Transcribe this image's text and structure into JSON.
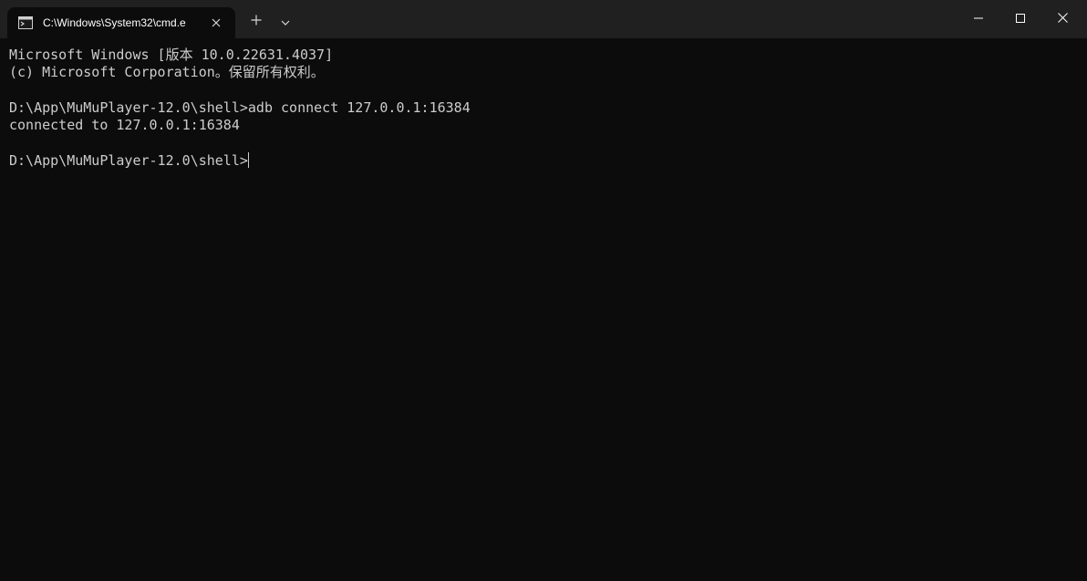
{
  "tab": {
    "title": "C:\\Windows\\System32\\cmd.e",
    "icon": "terminal-icon"
  },
  "titlebar": {
    "new_tab_icon": "plus-icon",
    "dropdown_icon": "chevron-down-icon",
    "minimize_icon": "minimize-icon",
    "maximize_icon": "maximize-icon",
    "close_icon": "close-icon"
  },
  "terminal": {
    "lines": [
      "Microsoft Windows [版本 10.0.22631.4037]",
      "(c) Microsoft Corporation。保留所有权利。",
      "",
      "D:\\App\\MuMuPlayer-12.0\\shell>adb connect 127.0.0.1:16384",
      "connected to 127.0.0.1:16384",
      "",
      "D:\\App\\MuMuPlayer-12.0\\shell>"
    ]
  },
  "colors": {
    "background": "#0c0c0c",
    "titlebar": "#202020",
    "text": "#cccccc"
  }
}
